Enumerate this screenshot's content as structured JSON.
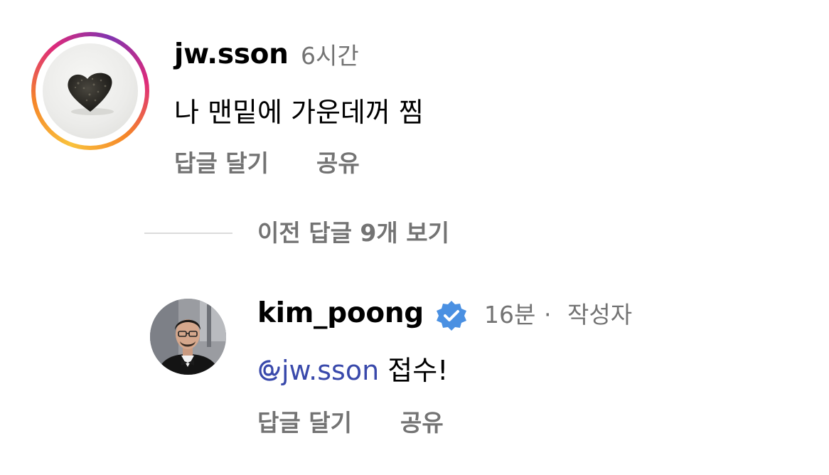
{
  "comment": {
    "username": "jw.sson",
    "time": "6시간",
    "text": "나 맨밑에 가운데꺼 찜",
    "actions": {
      "reply": "답글 달기",
      "share": "공유"
    }
  },
  "view_replies": {
    "label": "이전 답글 9개 보기"
  },
  "reply": {
    "username": "kim_poong",
    "verified": true,
    "time": "16분",
    "separator": "·",
    "author_badge": "작성자",
    "mention": "jw.sson",
    "text": "접수!",
    "actions": {
      "reply": "답글 달기",
      "share": "공유"
    }
  },
  "colors": {
    "username": "#000000",
    "secondary_text": "#737373",
    "mention": "#3949ab",
    "verified_badge": "#4a90e2",
    "divider": "#dbdbdb"
  },
  "icons": {
    "story_ring": "story-ring-gradient",
    "verified": "verified-badge-icon",
    "mention": "threads-at-icon"
  }
}
